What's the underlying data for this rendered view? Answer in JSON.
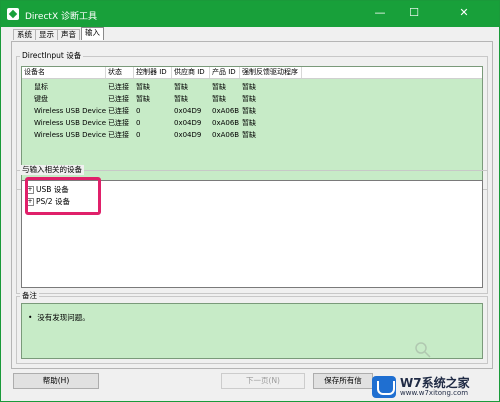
{
  "window": {
    "title": "DirectX 诊断工具",
    "controls": {
      "minimize": "—",
      "maximize": "☐",
      "close": "✕"
    }
  },
  "tabs": [
    {
      "label": "系统",
      "active": false
    },
    {
      "label": "显示",
      "active": false
    },
    {
      "label": "声音",
      "active": false
    },
    {
      "label": "输入",
      "active": true
    }
  ],
  "directinput": {
    "group_label": "DirectInput 设备",
    "columns": [
      "设备名",
      "状态",
      "控制器 ID",
      "供应商 ID",
      "产品 ID",
      "强制反馈驱动程序"
    ],
    "rows": [
      [
        "鼠标",
        "已连接",
        "暂缺",
        "暂缺",
        "暂缺",
        "暂缺"
      ],
      [
        "键盘",
        "已连接",
        "暂缺",
        "暂缺",
        "暂缺",
        "暂缺"
      ],
      [
        "Wireless USB Device",
        "已连接",
        "0",
        "0x04D9",
        "0xA06B",
        "暂缺"
      ],
      [
        "Wireless USB Device",
        "已连接",
        "0",
        "0x04D9",
        "0xA06B",
        "暂缺"
      ],
      [
        "Wireless USB Device",
        "已连接",
        "0",
        "0x04D9",
        "0xA06B",
        "暂缺"
      ]
    ]
  },
  "related": {
    "group_label": "与输入相关的设备",
    "items": [
      "USB 设备",
      "PS/2 设备"
    ],
    "expander": "+",
    "highlight_color": "#e0206a"
  },
  "notes": {
    "group_label": "备注",
    "items": [
      "没有发现问题。"
    ],
    "bullet": "•"
  },
  "buttons": {
    "help": "帮助(H)",
    "next": "下一页(N)",
    "save": "保存所有信"
  },
  "watermark": {
    "brand": "W7系统之家",
    "url": "www.w7xitong.com",
    "logo_color": "#1f6fd1"
  },
  "colors": {
    "titlebar": "#18a03a",
    "list_bg": "#c7ebc7"
  }
}
